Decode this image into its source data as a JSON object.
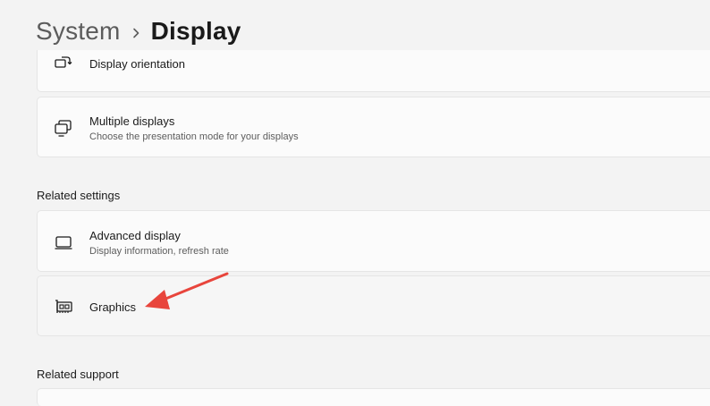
{
  "breadcrumb": {
    "parent": "System",
    "separator_icon": "chevron-right-icon",
    "current": "Display"
  },
  "cards": {
    "display_orientation": {
      "title": "Display orientation",
      "icon": "display-orientation-icon"
    },
    "multiple_displays": {
      "title": "Multiple displays",
      "description": "Choose the presentation mode for your displays",
      "icon": "multiple-displays-icon"
    },
    "advanced_display": {
      "title": "Advanced display",
      "description": "Display information, refresh rate",
      "icon": "monitor-icon"
    },
    "graphics": {
      "title": "Graphics",
      "icon": "graphics-card-icon"
    }
  },
  "sections": {
    "related_settings": "Related settings",
    "related_support": "Related support"
  },
  "colors": {
    "background": "#f3f3f3",
    "card": "#fbfbfb",
    "annotation_arrow": "#e8453c"
  }
}
